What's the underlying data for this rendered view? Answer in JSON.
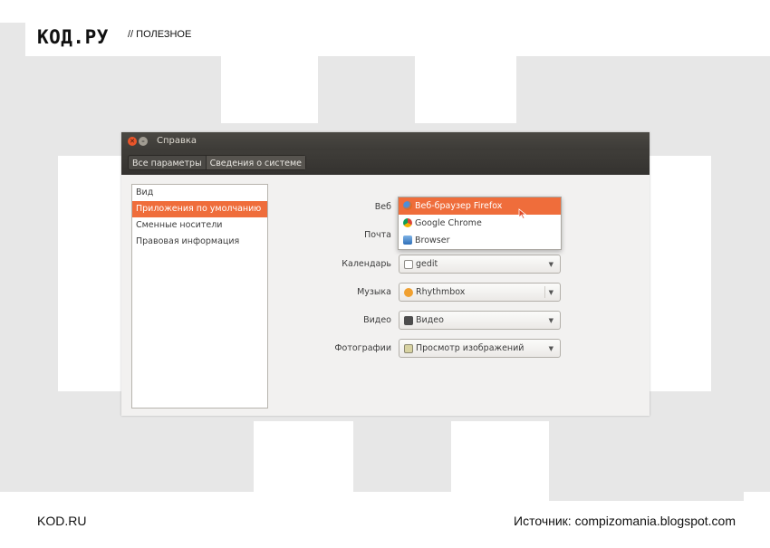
{
  "header": {
    "logo": "КОД.РУ",
    "section": "//  ПОЛЕЗНОЕ"
  },
  "footer": {
    "site": "KOD.RU",
    "source": "Источник: compizomania.blogspot.com"
  },
  "window": {
    "title": "Справка",
    "breadcrumbs": [
      "Все параметры",
      "Сведения о системе"
    ],
    "sidebar": {
      "items": [
        "Вид",
        "Приложения по умолчанию",
        "Сменные носители",
        "Правовая информация"
      ],
      "selected_index": 1
    },
    "settings": {
      "web": {
        "label": "Веб"
      },
      "mail": {
        "label": "Почта"
      },
      "calendar": {
        "label": "Календарь",
        "value": "gedit",
        "icon": "text-editor-icon"
      },
      "music": {
        "label": "Музыка",
        "value": "Rhythmbox",
        "icon": "rhythmbox-icon"
      },
      "video": {
        "label": "Видео",
        "value": "Видео",
        "icon": "video-icon"
      },
      "photos": {
        "label": "Фотографии",
        "value": "Просмотр изображений",
        "icon": "image-viewer-icon"
      }
    },
    "web_dropdown": {
      "options": [
        {
          "label": "Веб-браузер Firefox",
          "icon": "firefox-icon",
          "highlighted": true
        },
        {
          "label": "Google Chrome",
          "icon": "chrome-icon",
          "highlighted": false
        },
        {
          "label": "Browser",
          "icon": "browser-icon",
          "highlighted": false
        }
      ]
    }
  },
  "colors": {
    "accent": "#ef6d3b",
    "titlebar": "#3d3b37",
    "window_bg": "#f2f1f0",
    "page_bg": "#e7e7e7"
  }
}
